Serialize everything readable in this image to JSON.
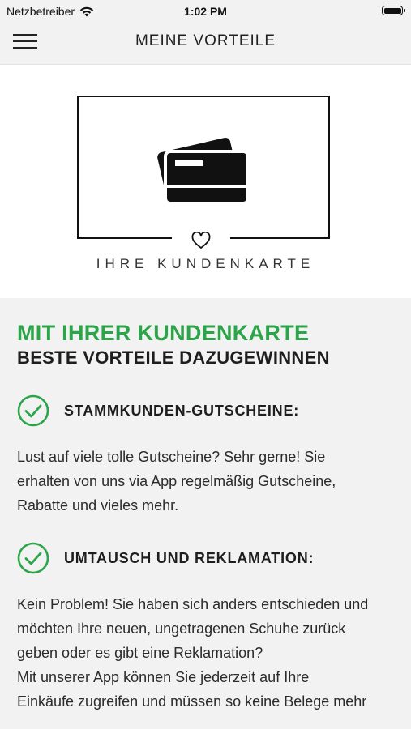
{
  "status_bar": {
    "carrier": "Netzbetreiber",
    "time": "1:02 PM"
  },
  "nav": {
    "title": "MEINE VORTEILE"
  },
  "hero": {
    "label": "IHRE KUNDENKARTE"
  },
  "headline": {
    "primary": "MIT IHRER KUNDENKARTE",
    "secondary": "BESTE VORTEILE DAZUGEWINNEN",
    "accent_color": "#2ca44a"
  },
  "benefits": [
    {
      "title": "STAMMKUNDEN-GUTSCHEINE:",
      "text": "Lust auf viele tolle Gutscheine? Sehr gerne! Sie\nerhalten von uns via App regelmäßig Gutscheine,\nRabatte und vieles mehr."
    },
    {
      "title": "UMTAUSCH UND REKLAMATION:",
      "text": "Kein Problem! Sie haben sich anders entschieden und\nmöchten Ihre neuen, ungetragenen Schuhe zurück\ngeben oder es gibt eine Reklamation?\nMit unserer App können Sie jederzeit auf Ihre\nEinkäufe zugreifen und müssen so keine Belege mehr"
    }
  ]
}
